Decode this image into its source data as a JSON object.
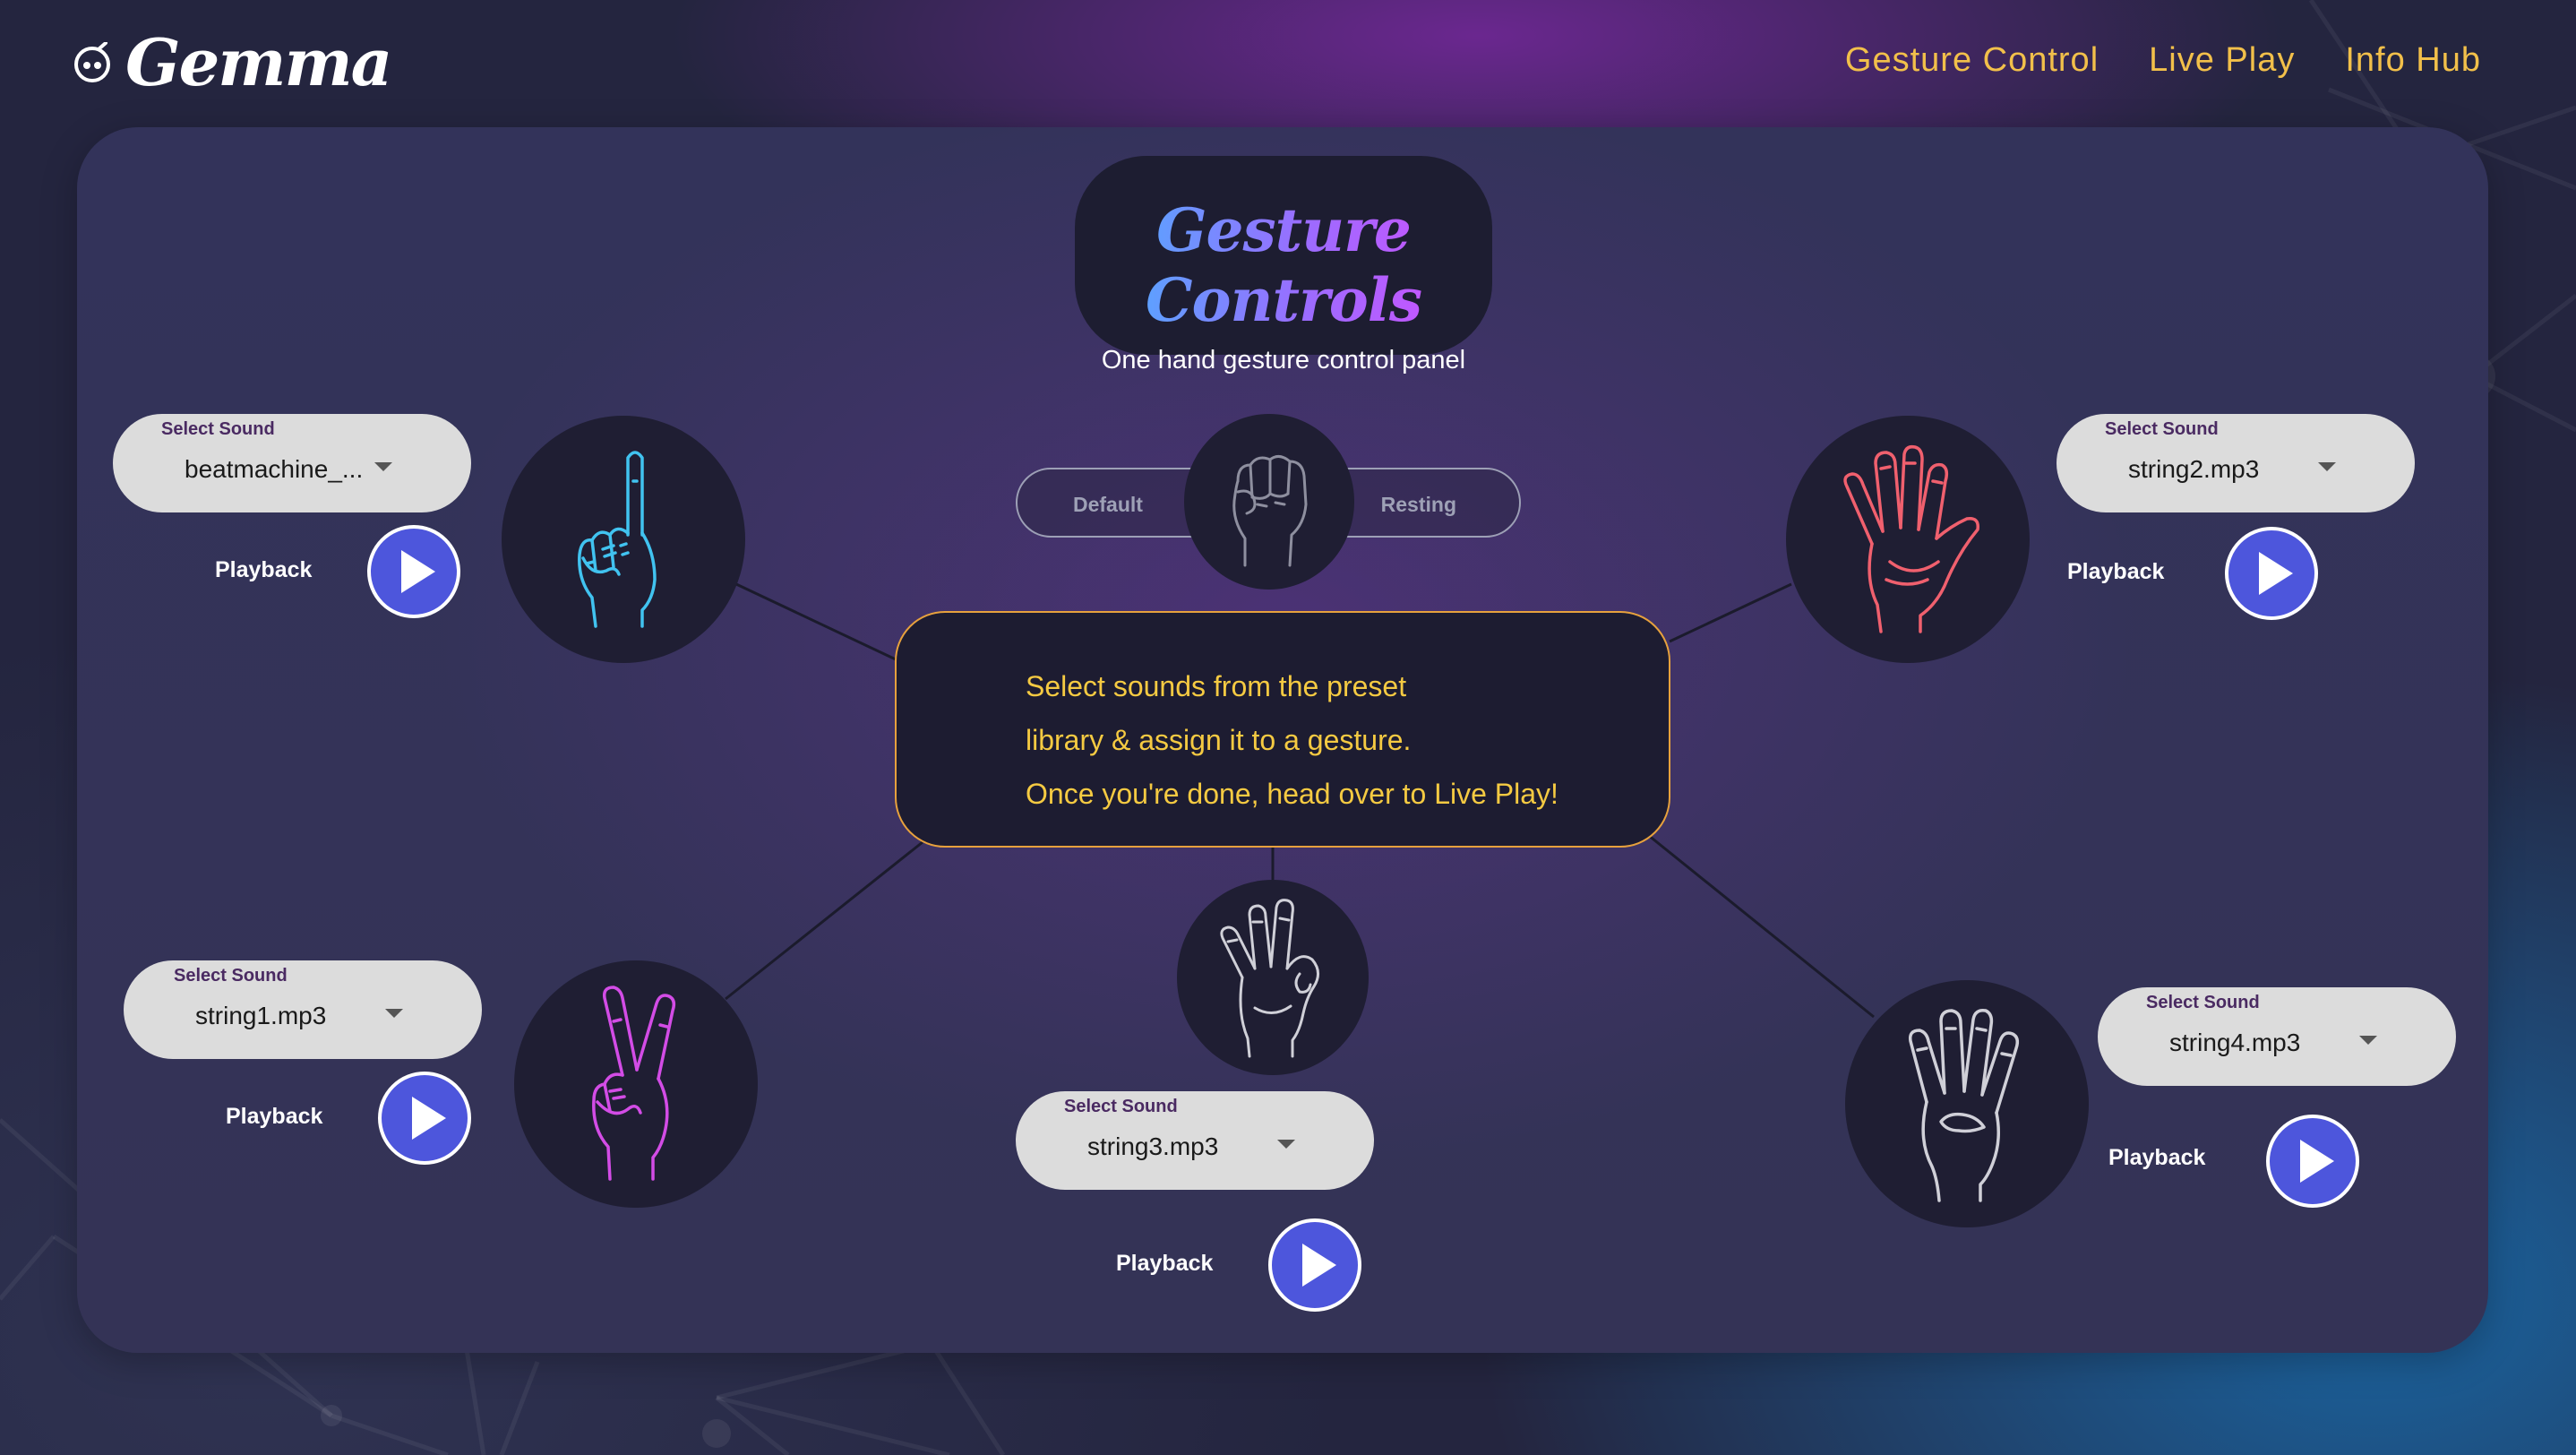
{
  "header": {
    "logo_text": "Gemma",
    "nav": [
      {
        "label": "Gesture Control"
      },
      {
        "label": "Live Play"
      },
      {
        "label": "Info Hub"
      }
    ]
  },
  "title_card": {
    "title": "Gesture Controls",
    "subtitle": "One hand gesture control panel"
  },
  "center_message": {
    "lines": [
      "Select sounds from the preset",
      "library & assign it to a gesture.",
      "Once you're done, head over to Live Play!"
    ]
  },
  "default_gesture": {
    "left_label": "Default",
    "right_label": "Resting",
    "icon": "fist-icon"
  },
  "gestures": [
    {
      "icon": "index-finger-icon",
      "color": "#41c3f0",
      "select_label": "Select Sound",
      "select_value": "beatmachine_...",
      "playback_label": "Playback"
    },
    {
      "icon": "open-palm-icon",
      "color": "#f0606e",
      "select_label": "Select Sound",
      "select_value": "string2.mp3",
      "playback_label": "Playback"
    },
    {
      "icon": "peace-sign-icon",
      "color": "#d34ce6",
      "select_label": "Select Sound",
      "select_value": "string1.mp3",
      "playback_label": "Playback"
    },
    {
      "icon": "three-fingers-icon",
      "color": "#d0d0d8",
      "select_label": "Select Sound",
      "select_value": "string3.mp3",
      "playback_label": "Playback"
    },
    {
      "icon": "four-fingers-icon",
      "color": "#d0d0d8",
      "select_label": "Select Sound",
      "select_value": "string4.mp3",
      "playback_label": "Playback"
    }
  ],
  "colors": {
    "nav": "#f2c04a",
    "message": "#f5ca42",
    "play_button": "#4d56dc",
    "center_border": "#e7a13d"
  }
}
